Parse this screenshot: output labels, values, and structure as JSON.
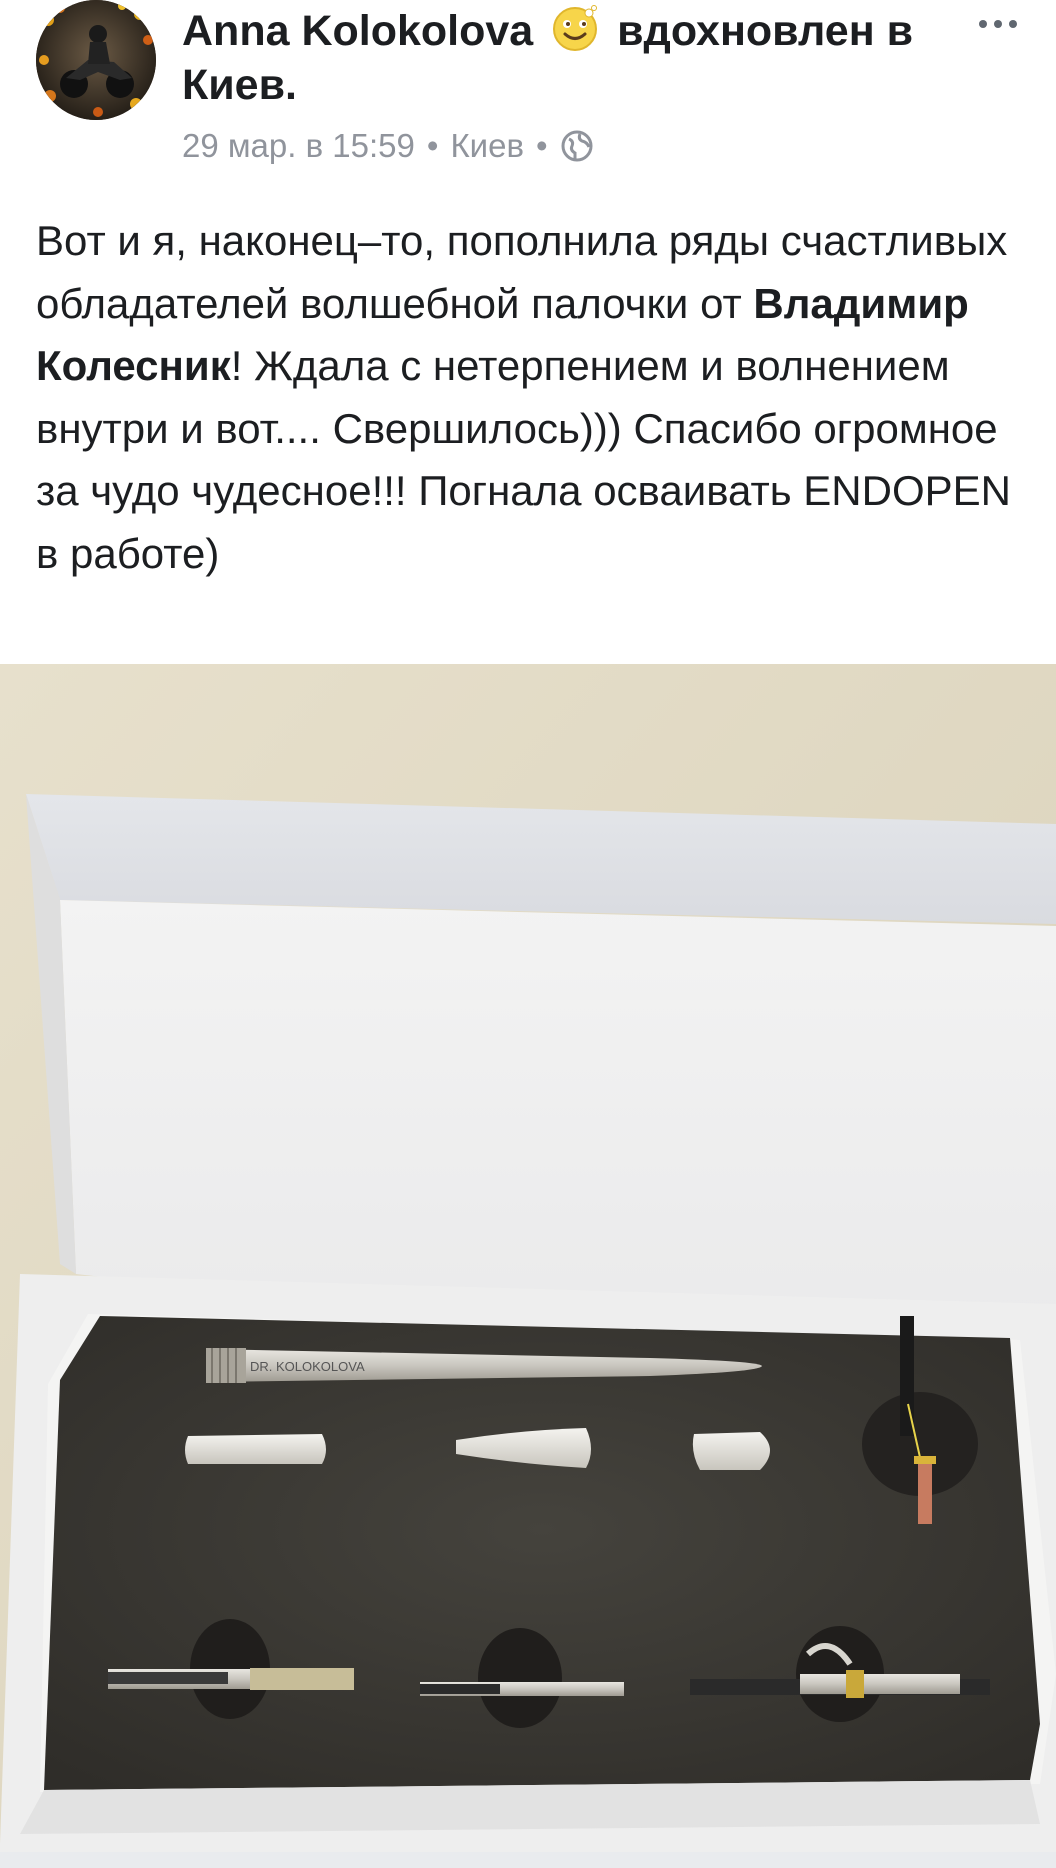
{
  "post": {
    "author": "Anna Kolokolova",
    "feeling": "вдохновлен в",
    "place": "Киев.",
    "timestamp": "29 мар. в 15:59",
    "location": "Киев",
    "separator": "•",
    "privacy_icon": "globe-icon",
    "feeling_icon": "inspired-face-emoji",
    "text": {
      "part1": "Вот и я,  наконец–то, пополнила ряды счастливых обладателей волшебной палочки от ",
      "mention": "Владимир Колесник",
      "part2": "! Ждала с нетерпением и волнением внутри и вот.... Свершилось)))  Спасибо огромное за чудо чудесное!!! Погнала осваивать ENDOPEN  в работе)"
    },
    "photo": {
      "engraving": "DR. KOLOKOLOVA",
      "description_icon": "product-box-photo"
    }
  },
  "colors": {
    "text": "#1c1e21",
    "meta": "#90949c",
    "foam": "#3d3b36",
    "box": "#f2f2f1",
    "background_wall": "#e6dfcb"
  }
}
